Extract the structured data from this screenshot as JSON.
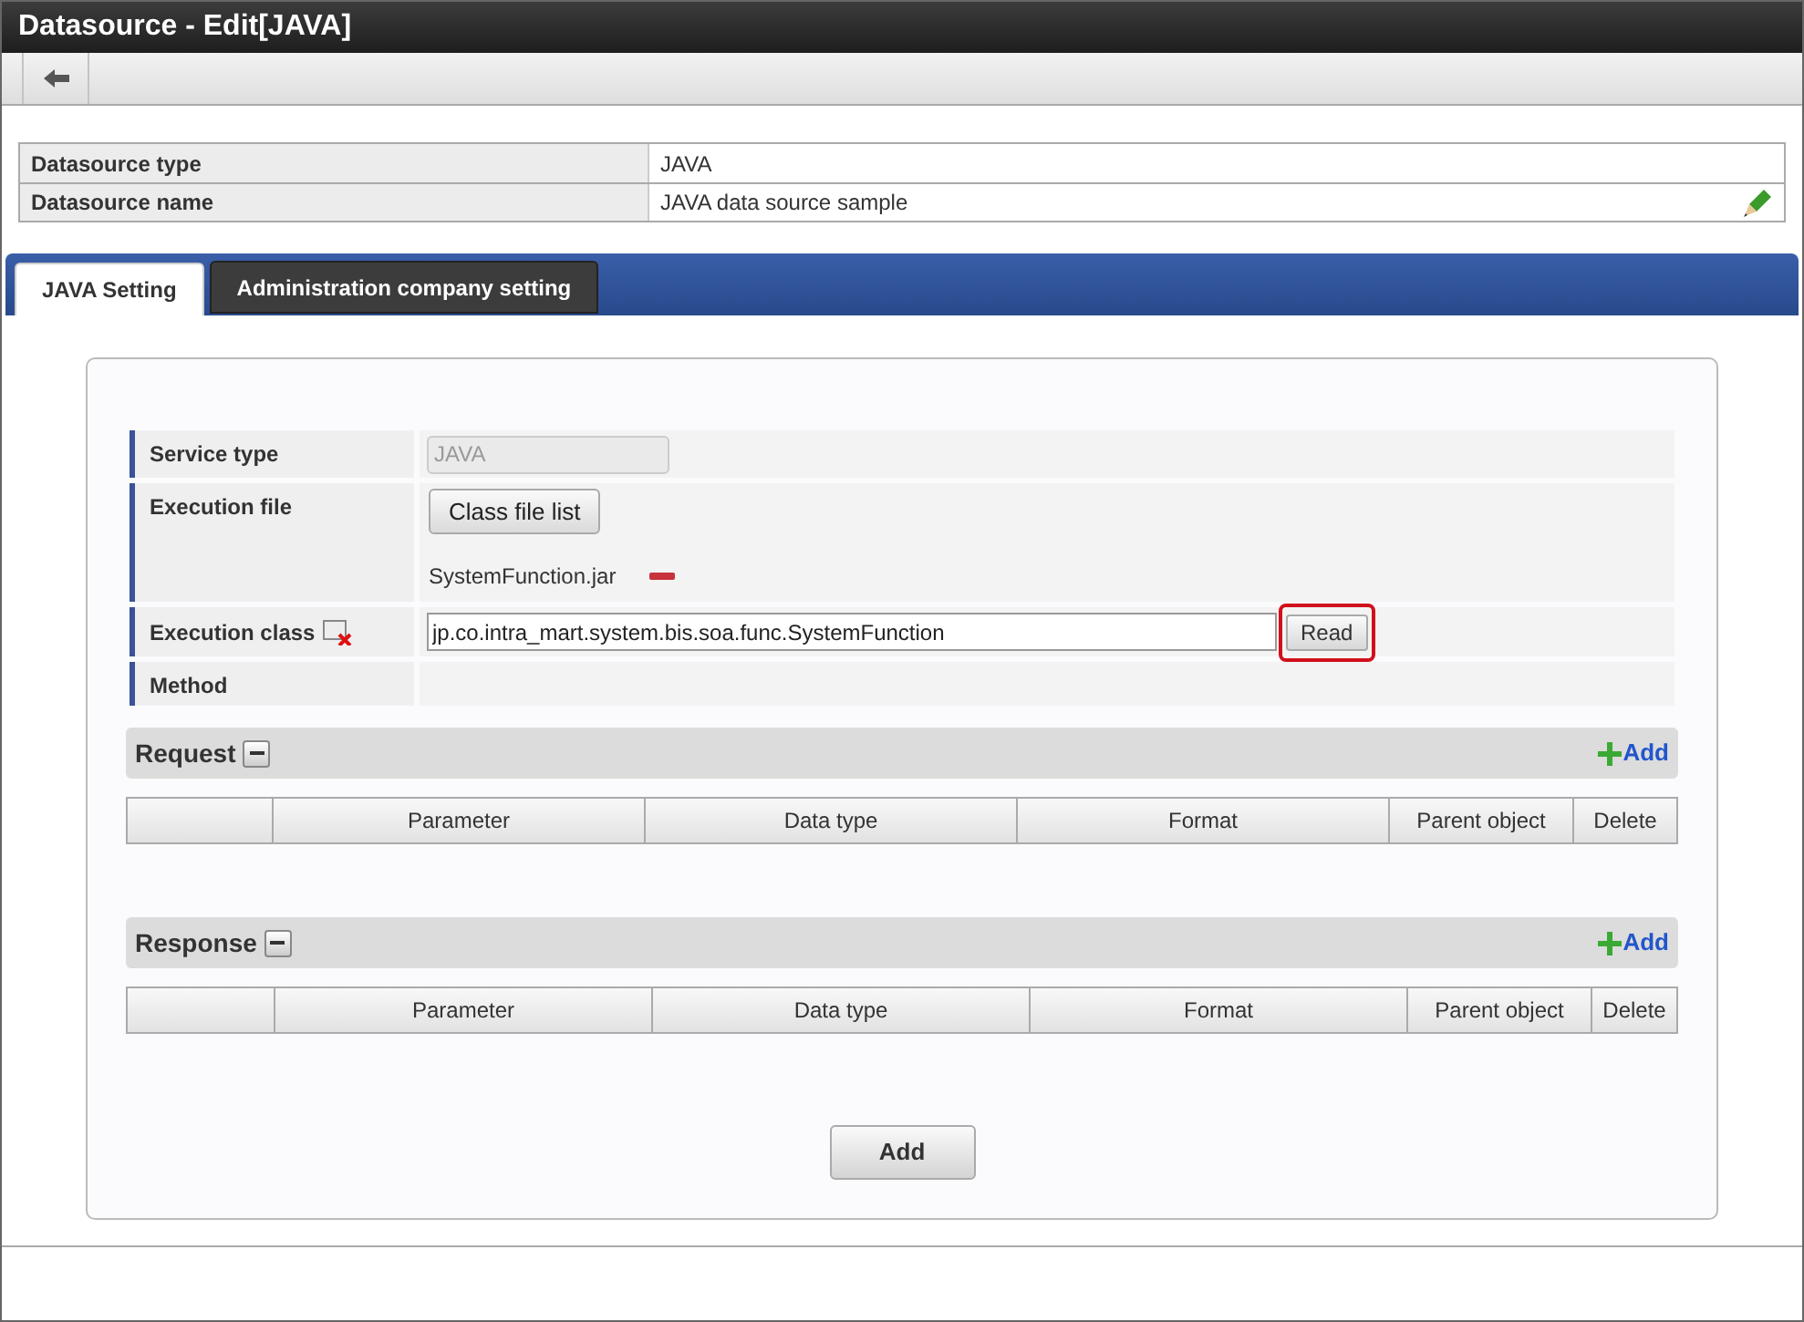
{
  "window": {
    "title": "Datasource - Edit[JAVA]"
  },
  "info": [
    {
      "label": "Datasource type",
      "value": "JAVA",
      "editable": false
    },
    {
      "label": "Datasource name",
      "value": "JAVA data source sample",
      "editable": true
    }
  ],
  "tabs": [
    {
      "label": "JAVA Setting",
      "selected": true
    },
    {
      "label": "Administration company setting",
      "selected": false
    }
  ],
  "form": {
    "service_type": {
      "label": "Service type",
      "value": "JAVA",
      "disabled": true
    },
    "execution_file": {
      "label": "Execution file",
      "button": "Class file list",
      "file": "SystemFunction.jar"
    },
    "execution_class": {
      "label": "Execution class",
      "value": "jp.co.intra_mart.system.bis.soa.func.SystemFunction",
      "button": "Read",
      "highlighted": true
    },
    "method": {
      "label": "Method"
    }
  },
  "sections": [
    {
      "title": "Request",
      "add": "Add",
      "columns": [
        "Parameter",
        "Data type",
        "Format",
        "Parent object",
        "Delete"
      ]
    },
    {
      "title": "Response",
      "add": "Add",
      "columns": [
        "Parameter",
        "Data type",
        "Format",
        "Parent object",
        "Delete"
      ]
    }
  ],
  "add_button": "Add"
}
